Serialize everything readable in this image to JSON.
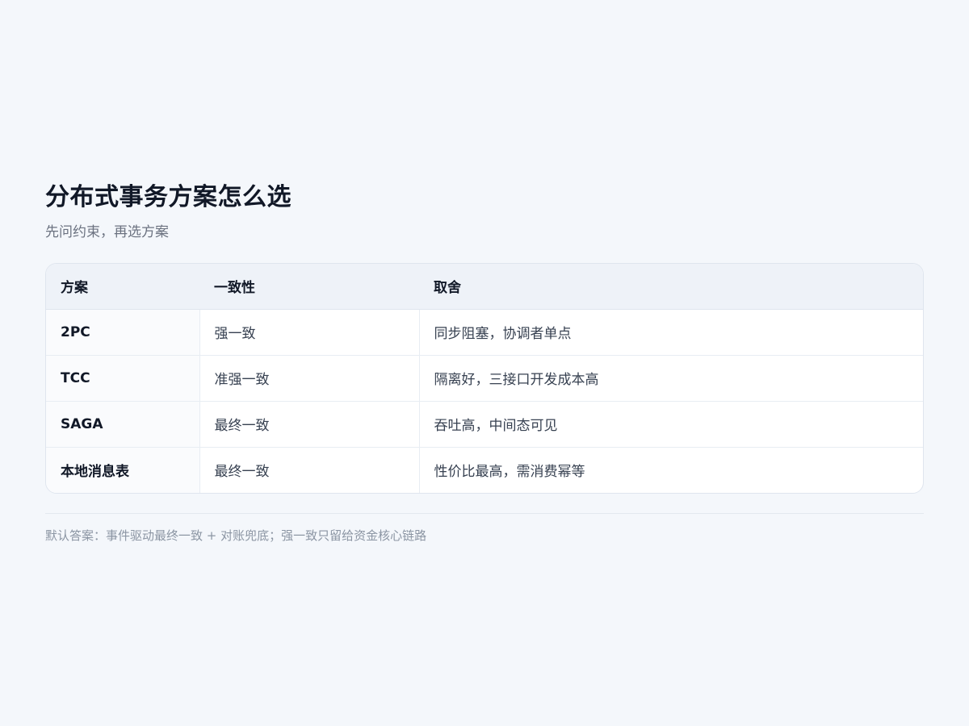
{
  "title": "分布式事务方案怎么选",
  "subtitle": "先问约束，再选方案",
  "table": {
    "headers": [
      "方案",
      "一致性",
      "取舍"
    ],
    "rows": [
      [
        "2PC",
        "强一致",
        "同步阻塞，协调者单点"
      ],
      [
        "TCC",
        "准强一致",
        "隔离好，三接口开发成本高"
      ],
      [
        "SAGA",
        "最终一致",
        "吞吐高，中间态可见"
      ],
      [
        "本地消息表",
        "最终一致",
        "性价比最高，需消费幂等"
      ]
    ]
  },
  "footnote": "默认答案：事件驱动最终一致 + 对账兜底；强一致只留给资金核心链路"
}
